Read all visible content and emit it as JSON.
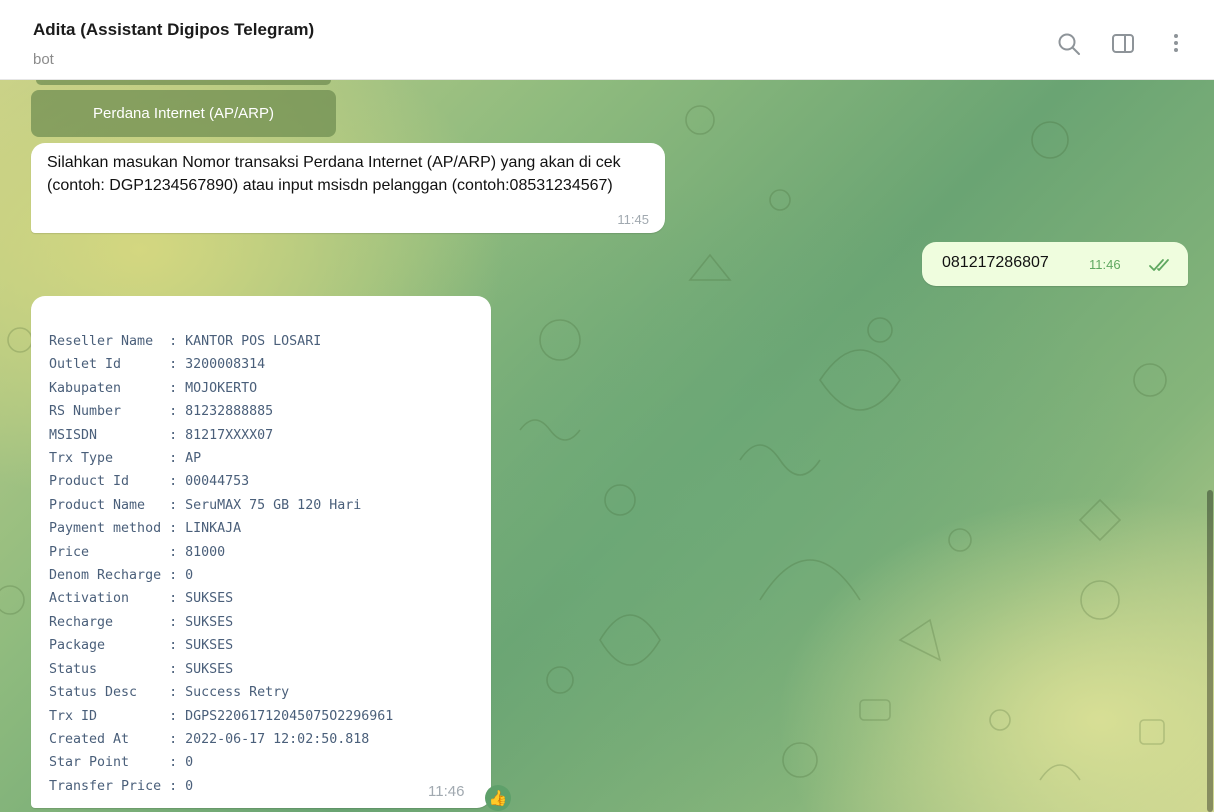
{
  "header": {
    "title": "Adita (Assistant Digipos Telegram)",
    "subtitle": "bot",
    "icons": [
      "search-icon",
      "sidebar-toggle-icon",
      "more-vertical-icon"
    ]
  },
  "keyboard_button": {
    "label": "Perdana Internet (AP/ARP)"
  },
  "messages": [
    {
      "direction": "incoming",
      "text": "Silahkan masukan Nomor transaksi Perdana Internet (AP/ARP) yang akan di cek (contoh: DGP1234567890) atau input msisdn pelanggan (contoh:08531234567)",
      "time": "11:45"
    },
    {
      "direction": "outgoing",
      "text": "081217286807",
      "time": "11:46",
      "status": "read"
    },
    {
      "direction": "incoming",
      "time": "11:46",
      "reaction": "👍",
      "rows": [
        {
          "key": "Reseller Name",
          "value": "KANTOR POS LOSARI"
        },
        {
          "key": "Outlet Id",
          "value": "3200008314"
        },
        {
          "key": "Kabupaten",
          "value": "MOJOKERTO"
        },
        {
          "key": "RS Number",
          "value": "81232888885"
        },
        {
          "key": "MSISDN",
          "value": "81217XXXX07"
        },
        {
          "key": "Trx Type",
          "value": "AP"
        },
        {
          "key": "Product Id",
          "value": "00044753"
        },
        {
          "key": "Product Name",
          "value": "SeruMAX 75 GB 120 Hari"
        },
        {
          "key": "Payment method",
          "value": "LINKAJA"
        },
        {
          "key": "Price",
          "value": "81000"
        },
        {
          "key": "Denom Recharge",
          "value": "0"
        },
        {
          "key": "Activation",
          "value": "SUKSES"
        },
        {
          "key": "Recharge",
          "value": "SUKSES"
        },
        {
          "key": "Package",
          "value": "SUKSES"
        },
        {
          "key": "Status",
          "value": "SUKSES"
        },
        {
          "key": "Status Desc",
          "value": "Success Retry"
        },
        {
          "key": "Trx ID",
          "value": "DGPS22061712045075O2296961"
        },
        {
          "key": "Created At",
          "value": "2022-06-17 12:02:50.818"
        },
        {
          "key": "Star Point",
          "value": "0"
        },
        {
          "key": "Transfer Price",
          "value": "0"
        }
      ]
    }
  ],
  "colors": {
    "incoming_bubble": "#ffffff",
    "outgoing_bubble": "#effdde",
    "read_check": "#5fa860",
    "keyboard_button": "#6e8c50",
    "mono_text": "#4a5f7a"
  }
}
